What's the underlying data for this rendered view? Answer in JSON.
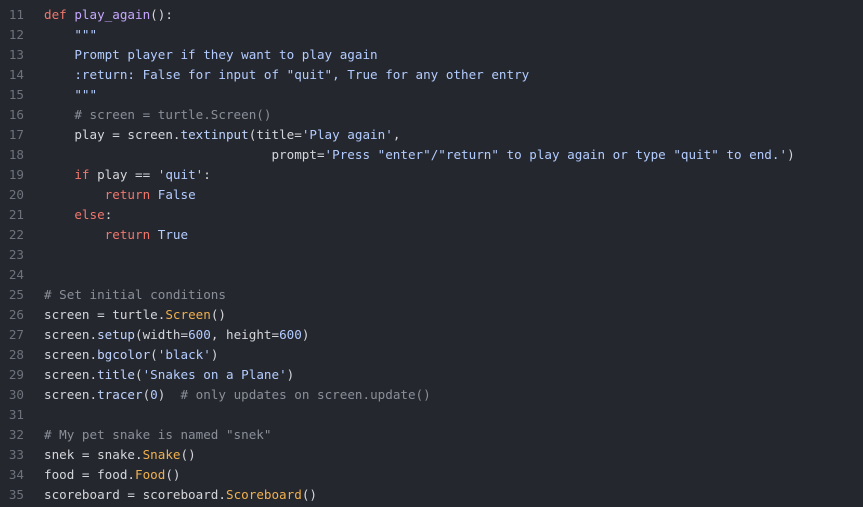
{
  "editor": {
    "lines": [
      {
        "num": "11",
        "tokens": [
          {
            "t": "def",
            "c": "kw"
          },
          {
            "t": " ",
            "c": "txt"
          },
          {
            "t": "play_again",
            "c": "fn"
          },
          {
            "t": "():",
            "c": "txt"
          }
        ]
      },
      {
        "num": "12",
        "tokens": [
          {
            "t": "    \"\"\"",
            "c": "doc"
          }
        ]
      },
      {
        "num": "13",
        "tokens": [
          {
            "t": "    Prompt player if they want to play again",
            "c": "doc"
          }
        ]
      },
      {
        "num": "14",
        "tokens": [
          {
            "t": "    :return: False for input of \"quit\", True for any other entry",
            "c": "doc"
          }
        ]
      },
      {
        "num": "15",
        "tokens": [
          {
            "t": "    \"\"\"",
            "c": "doc"
          }
        ]
      },
      {
        "num": "16",
        "tokens": [
          {
            "t": "    # screen = turtle.Screen()",
            "c": "cmt"
          }
        ]
      },
      {
        "num": "17",
        "tokens": [
          {
            "t": "    play = screen.",
            "c": "txt"
          },
          {
            "t": "textinput",
            "c": "meth"
          },
          {
            "t": "(title=",
            "c": "txt"
          },
          {
            "t": "'Play again'",
            "c": "str"
          },
          {
            "t": ",",
            "c": "txt"
          }
        ]
      },
      {
        "num": "18",
        "tokens": [
          {
            "t": "                              prompt=",
            "c": "txt"
          },
          {
            "t": "'Press \"enter\"/\"return\" to play again or type \"quit\" to end.'",
            "c": "str"
          },
          {
            "t": ")",
            "c": "txt"
          }
        ]
      },
      {
        "num": "19",
        "tokens": [
          {
            "t": "    ",
            "c": "txt"
          },
          {
            "t": "if",
            "c": "kw"
          },
          {
            "t": " play == ",
            "c": "txt"
          },
          {
            "t": "'quit'",
            "c": "str"
          },
          {
            "t": ":",
            "c": "txt"
          }
        ]
      },
      {
        "num": "20",
        "tokens": [
          {
            "t": "        ",
            "c": "txt"
          },
          {
            "t": "return",
            "c": "kw"
          },
          {
            "t": " ",
            "c": "txt"
          },
          {
            "t": "False",
            "c": "bool"
          }
        ]
      },
      {
        "num": "21",
        "tokens": [
          {
            "t": "    ",
            "c": "txt"
          },
          {
            "t": "else",
            "c": "kw"
          },
          {
            "t": ":",
            "c": "txt"
          }
        ]
      },
      {
        "num": "22",
        "tokens": [
          {
            "t": "        ",
            "c": "txt"
          },
          {
            "t": "return",
            "c": "kw"
          },
          {
            "t": " ",
            "c": "txt"
          },
          {
            "t": "True",
            "c": "bool"
          }
        ]
      },
      {
        "num": "23",
        "tokens": []
      },
      {
        "num": "24",
        "tokens": []
      },
      {
        "num": "25",
        "tokens": [
          {
            "t": "# Set initial conditions",
            "c": "cmt"
          }
        ]
      },
      {
        "num": "26",
        "tokens": [
          {
            "t": "screen = turtle.",
            "c": "txt"
          },
          {
            "t": "Screen",
            "c": "cls"
          },
          {
            "t": "()",
            "c": "txt"
          }
        ]
      },
      {
        "num": "27",
        "tokens": [
          {
            "t": "screen.",
            "c": "txt"
          },
          {
            "t": "setup",
            "c": "meth"
          },
          {
            "t": "(width=",
            "c": "txt"
          },
          {
            "t": "600",
            "c": "num"
          },
          {
            "t": ", height=",
            "c": "txt"
          },
          {
            "t": "600",
            "c": "num"
          },
          {
            "t": ")",
            "c": "txt"
          }
        ]
      },
      {
        "num": "28",
        "tokens": [
          {
            "t": "screen.",
            "c": "txt"
          },
          {
            "t": "bgcolor",
            "c": "meth"
          },
          {
            "t": "(",
            "c": "txt"
          },
          {
            "t": "'black'",
            "c": "str"
          },
          {
            "t": ")",
            "c": "txt"
          }
        ]
      },
      {
        "num": "29",
        "tokens": [
          {
            "t": "screen.",
            "c": "txt"
          },
          {
            "t": "title",
            "c": "meth"
          },
          {
            "t": "(",
            "c": "txt"
          },
          {
            "t": "'Snakes on a Plane'",
            "c": "str"
          },
          {
            "t": ")",
            "c": "txt"
          }
        ]
      },
      {
        "num": "30",
        "tokens": [
          {
            "t": "screen.",
            "c": "txt"
          },
          {
            "t": "tracer",
            "c": "meth"
          },
          {
            "t": "(",
            "c": "txt"
          },
          {
            "t": "0",
            "c": "num"
          },
          {
            "t": ")  ",
            "c": "txt"
          },
          {
            "t": "# only updates on screen.update()",
            "c": "cmt"
          }
        ]
      },
      {
        "num": "31",
        "tokens": []
      },
      {
        "num": "32",
        "tokens": [
          {
            "t": "# My pet snake is named \"snek\"",
            "c": "cmt"
          }
        ]
      },
      {
        "num": "33",
        "tokens": [
          {
            "t": "snek = snake.",
            "c": "txt"
          },
          {
            "t": "Snake",
            "c": "cls"
          },
          {
            "t": "()",
            "c": "txt"
          }
        ]
      },
      {
        "num": "34",
        "tokens": [
          {
            "t": "food = food.",
            "c": "txt"
          },
          {
            "t": "Food",
            "c": "cls"
          },
          {
            "t": "()",
            "c": "txt"
          }
        ]
      },
      {
        "num": "35",
        "tokens": [
          {
            "t": "scoreboard = scoreboard.",
            "c": "txt"
          },
          {
            "t": "Scoreboard",
            "c": "cls"
          },
          {
            "t": "()",
            "c": "txt"
          }
        ]
      }
    ]
  }
}
